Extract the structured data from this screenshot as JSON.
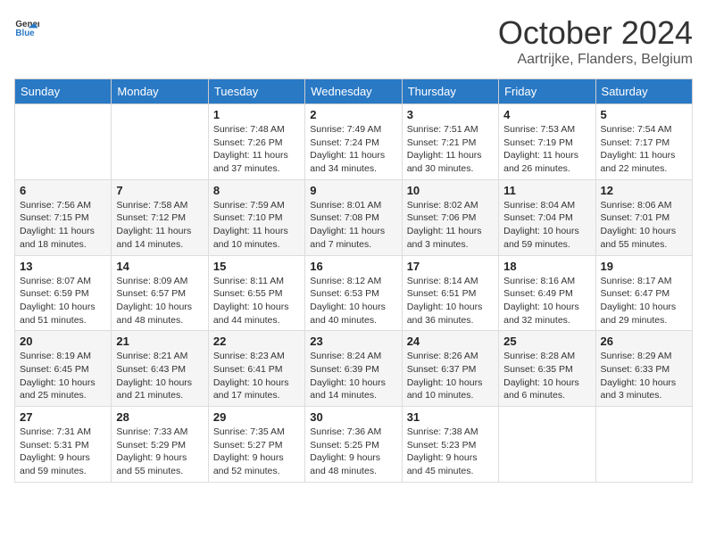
{
  "header": {
    "logo_general": "General",
    "logo_blue": "Blue",
    "month": "October 2024",
    "location": "Aartrijke, Flanders, Belgium"
  },
  "weekdays": [
    "Sunday",
    "Monday",
    "Tuesday",
    "Wednesday",
    "Thursday",
    "Friday",
    "Saturday"
  ],
  "weeks": [
    [
      {
        "day": "",
        "sunrise": "",
        "sunset": "",
        "daylight": ""
      },
      {
        "day": "",
        "sunrise": "",
        "sunset": "",
        "daylight": ""
      },
      {
        "day": "1",
        "sunrise": "Sunrise: 7:48 AM",
        "sunset": "Sunset: 7:26 PM",
        "daylight": "Daylight: 11 hours and 37 minutes."
      },
      {
        "day": "2",
        "sunrise": "Sunrise: 7:49 AM",
        "sunset": "Sunset: 7:24 PM",
        "daylight": "Daylight: 11 hours and 34 minutes."
      },
      {
        "day": "3",
        "sunrise": "Sunrise: 7:51 AM",
        "sunset": "Sunset: 7:21 PM",
        "daylight": "Daylight: 11 hours and 30 minutes."
      },
      {
        "day": "4",
        "sunrise": "Sunrise: 7:53 AM",
        "sunset": "Sunset: 7:19 PM",
        "daylight": "Daylight: 11 hours and 26 minutes."
      },
      {
        "day": "5",
        "sunrise": "Sunrise: 7:54 AM",
        "sunset": "Sunset: 7:17 PM",
        "daylight": "Daylight: 11 hours and 22 minutes."
      }
    ],
    [
      {
        "day": "6",
        "sunrise": "Sunrise: 7:56 AM",
        "sunset": "Sunset: 7:15 PM",
        "daylight": "Daylight: 11 hours and 18 minutes."
      },
      {
        "day": "7",
        "sunrise": "Sunrise: 7:58 AM",
        "sunset": "Sunset: 7:12 PM",
        "daylight": "Daylight: 11 hours and 14 minutes."
      },
      {
        "day": "8",
        "sunrise": "Sunrise: 7:59 AM",
        "sunset": "Sunset: 7:10 PM",
        "daylight": "Daylight: 11 hours and 10 minutes."
      },
      {
        "day": "9",
        "sunrise": "Sunrise: 8:01 AM",
        "sunset": "Sunset: 7:08 PM",
        "daylight": "Daylight: 11 hours and 7 minutes."
      },
      {
        "day": "10",
        "sunrise": "Sunrise: 8:02 AM",
        "sunset": "Sunset: 7:06 PM",
        "daylight": "Daylight: 11 hours and 3 minutes."
      },
      {
        "day": "11",
        "sunrise": "Sunrise: 8:04 AM",
        "sunset": "Sunset: 7:04 PM",
        "daylight": "Daylight: 10 hours and 59 minutes."
      },
      {
        "day": "12",
        "sunrise": "Sunrise: 8:06 AM",
        "sunset": "Sunset: 7:01 PM",
        "daylight": "Daylight: 10 hours and 55 minutes."
      }
    ],
    [
      {
        "day": "13",
        "sunrise": "Sunrise: 8:07 AM",
        "sunset": "Sunset: 6:59 PM",
        "daylight": "Daylight: 10 hours and 51 minutes."
      },
      {
        "day": "14",
        "sunrise": "Sunrise: 8:09 AM",
        "sunset": "Sunset: 6:57 PM",
        "daylight": "Daylight: 10 hours and 48 minutes."
      },
      {
        "day": "15",
        "sunrise": "Sunrise: 8:11 AM",
        "sunset": "Sunset: 6:55 PM",
        "daylight": "Daylight: 10 hours and 44 minutes."
      },
      {
        "day": "16",
        "sunrise": "Sunrise: 8:12 AM",
        "sunset": "Sunset: 6:53 PM",
        "daylight": "Daylight: 10 hours and 40 minutes."
      },
      {
        "day": "17",
        "sunrise": "Sunrise: 8:14 AM",
        "sunset": "Sunset: 6:51 PM",
        "daylight": "Daylight: 10 hours and 36 minutes."
      },
      {
        "day": "18",
        "sunrise": "Sunrise: 8:16 AM",
        "sunset": "Sunset: 6:49 PM",
        "daylight": "Daylight: 10 hours and 32 minutes."
      },
      {
        "day": "19",
        "sunrise": "Sunrise: 8:17 AM",
        "sunset": "Sunset: 6:47 PM",
        "daylight": "Daylight: 10 hours and 29 minutes."
      }
    ],
    [
      {
        "day": "20",
        "sunrise": "Sunrise: 8:19 AM",
        "sunset": "Sunset: 6:45 PM",
        "daylight": "Daylight: 10 hours and 25 minutes."
      },
      {
        "day": "21",
        "sunrise": "Sunrise: 8:21 AM",
        "sunset": "Sunset: 6:43 PM",
        "daylight": "Daylight: 10 hours and 21 minutes."
      },
      {
        "day": "22",
        "sunrise": "Sunrise: 8:23 AM",
        "sunset": "Sunset: 6:41 PM",
        "daylight": "Daylight: 10 hours and 17 minutes."
      },
      {
        "day": "23",
        "sunrise": "Sunrise: 8:24 AM",
        "sunset": "Sunset: 6:39 PM",
        "daylight": "Daylight: 10 hours and 14 minutes."
      },
      {
        "day": "24",
        "sunrise": "Sunrise: 8:26 AM",
        "sunset": "Sunset: 6:37 PM",
        "daylight": "Daylight: 10 hours and 10 minutes."
      },
      {
        "day": "25",
        "sunrise": "Sunrise: 8:28 AM",
        "sunset": "Sunset: 6:35 PM",
        "daylight": "Daylight: 10 hours and 6 minutes."
      },
      {
        "day": "26",
        "sunrise": "Sunrise: 8:29 AM",
        "sunset": "Sunset: 6:33 PM",
        "daylight": "Daylight: 10 hours and 3 minutes."
      }
    ],
    [
      {
        "day": "27",
        "sunrise": "Sunrise: 7:31 AM",
        "sunset": "Sunset: 5:31 PM",
        "daylight": "Daylight: 9 hours and 59 minutes."
      },
      {
        "day": "28",
        "sunrise": "Sunrise: 7:33 AM",
        "sunset": "Sunset: 5:29 PM",
        "daylight": "Daylight: 9 hours and 55 minutes."
      },
      {
        "day": "29",
        "sunrise": "Sunrise: 7:35 AM",
        "sunset": "Sunset: 5:27 PM",
        "daylight": "Daylight: 9 hours and 52 minutes."
      },
      {
        "day": "30",
        "sunrise": "Sunrise: 7:36 AM",
        "sunset": "Sunset: 5:25 PM",
        "daylight": "Daylight: 9 hours and 48 minutes."
      },
      {
        "day": "31",
        "sunrise": "Sunrise: 7:38 AM",
        "sunset": "Sunset: 5:23 PM",
        "daylight": "Daylight: 9 hours and 45 minutes."
      },
      {
        "day": "",
        "sunrise": "",
        "sunset": "",
        "daylight": ""
      },
      {
        "day": "",
        "sunrise": "",
        "sunset": "",
        "daylight": ""
      }
    ]
  ]
}
